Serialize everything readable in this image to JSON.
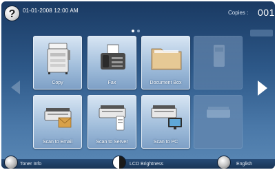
{
  "header": {
    "help_label": "?",
    "datetime": "01-01-2008 12:00 AM",
    "copies_label": "Copies :",
    "copies_value": "001"
  },
  "pager": {
    "pages": 2,
    "current": 1
  },
  "apps": [
    {
      "label": "Copy",
      "icon": "copier-icon",
      "enabled": true
    },
    {
      "label": "Fax",
      "icon": "fax-icon",
      "enabled": true
    },
    {
      "label": "Document Box",
      "icon": "folder-icon",
      "enabled": true
    },
    {
      "label": "",
      "icon": "device-icon",
      "enabled": false
    },
    {
      "label": "Scan to Email",
      "icon": "scan-to-email-icon",
      "enabled": true
    },
    {
      "label": "Scan to Server",
      "icon": "scan-to-server-icon",
      "enabled": true
    },
    {
      "label": "Scan to PC",
      "icon": "scan-to-pc-icon",
      "enabled": true
    },
    {
      "label": "",
      "icon": "scanner-icon",
      "enabled": false
    }
  ],
  "footer": {
    "toner_label": "Toner Info",
    "brightness_label": "LCD Brightness",
    "language_label": "English"
  },
  "colors": {
    "screen_top": "#1a3a63",
    "screen_bottom": "#5a88b5",
    "tile_light": "#d7e5f3",
    "tile_dark": "#7ea0c6"
  }
}
